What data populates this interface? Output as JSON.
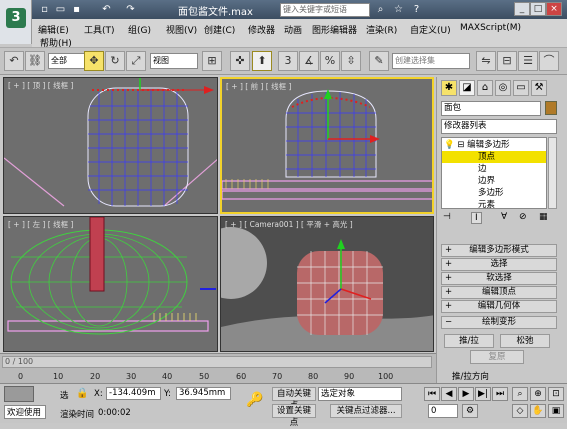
{
  "title": {
    "text": "面包酱文件.max",
    "search_placeholder": "键入关键字或短语"
  },
  "menu": [
    "编辑(E)",
    "工具(T)",
    "组(G)",
    "视图(V)",
    "创建(C)",
    "修改器",
    "动画",
    "图形编辑器",
    "渲染(R)",
    "自定义(U)",
    "MAXScript(M)",
    "帮助(H)"
  ],
  "toolbar": {
    "select_filter": "全部",
    "coord_system": "视图",
    "selection_set": "创建选择集",
    "num_label": "3"
  },
  "viewports": {
    "top": "[ + ] [ 顶 ] [ 线框 ]",
    "front": "[ + ] [ 前 ] [ 线框 ]",
    "left": "[ + ] [ 左 ] [ 线框 ]",
    "camera": "[ + ] [ Camera001 ] [ 平滑 + 高光 ]"
  },
  "cmdpanel": {
    "object_name": "面包",
    "modifier_list": "修改器列表",
    "stack": [
      "编辑多边形",
      "顶点",
      "边",
      "边界",
      "多边形",
      "元素"
    ],
    "rollouts": [
      "编辑多边形模式",
      "选择",
      "软选择",
      "编辑顶点",
      "编辑几何体",
      "绘制变形"
    ],
    "buttons": {
      "push_pull": "推/拉",
      "relax": "松弛",
      "revert": "复原",
      "push_pull_dir": "推/拉方向"
    }
  },
  "timeline": {
    "frame_label": "0 / 100",
    "ticks": [
      "0",
      "10",
      "20",
      "30",
      "40",
      "50",
      "60",
      "70",
      "80",
      "90",
      "100"
    ]
  },
  "status": {
    "welcome": "欢迎使用",
    "selected_label": "选",
    "x_label": "X:",
    "x_value": "-134.409m",
    "y_label": "Y:",
    "y_value": "36.945mm",
    "render_time_label": "渲染时间",
    "render_time": "0:00:02",
    "auto_key": "自动关键点",
    "selected_objects": "选定对象",
    "set_key": "设置关键点",
    "key_filters": "关键点过滤器...",
    "frame": "0"
  },
  "colors": {
    "active_border": "#f2d22a",
    "selection": "#f3e100"
  }
}
